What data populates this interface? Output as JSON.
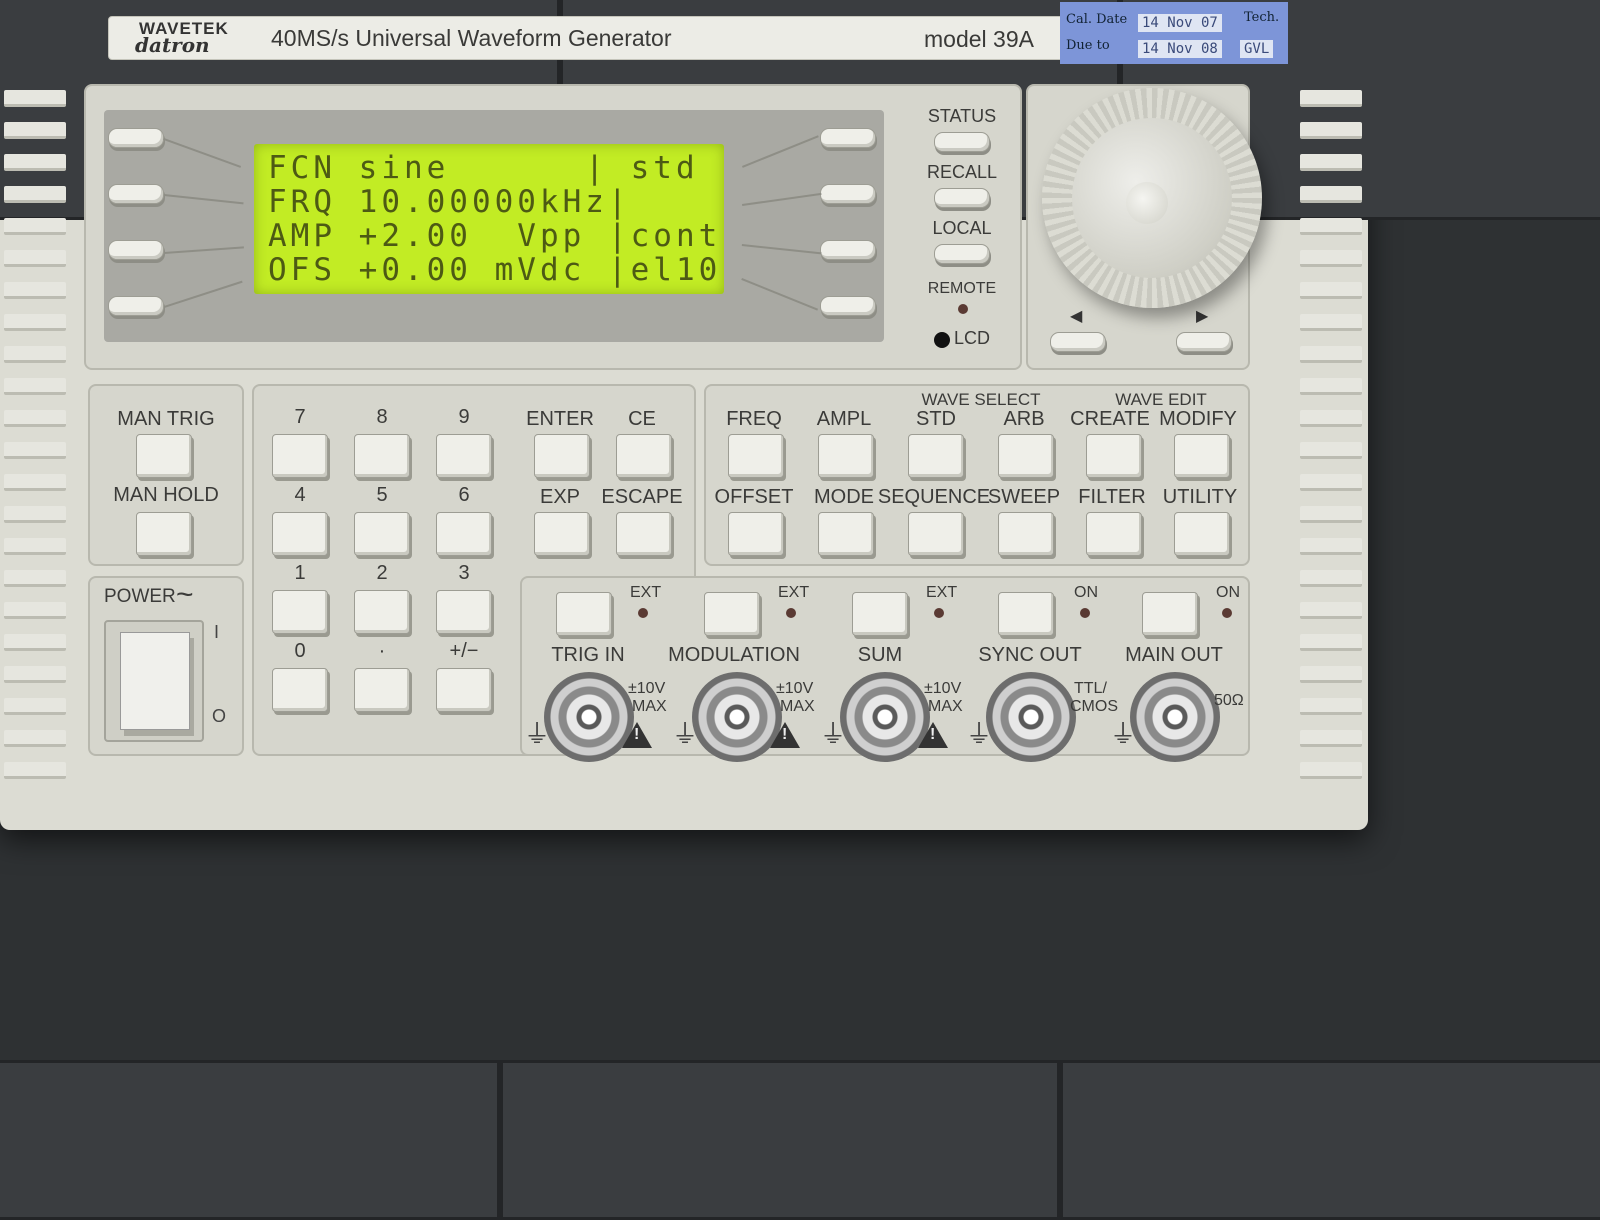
{
  "brand": {
    "line1": "WAVETEK",
    "line2": "datron"
  },
  "title": "40MS/s Universal Waveform Generator",
  "model": "model 39A",
  "calibration": {
    "cal_date_label": "Cal. Date",
    "cal_date": "14 Nov 07",
    "due_label": "Due to",
    "due_date": "14 Nov 08",
    "tech_label": "Tech.",
    "tech": "GVL"
  },
  "lcd": {
    "rows": [
      "FCN sine      | std",
      "FRQ 10.00000kHz|",
      "AMP +2.00  Vpp |cont",
      "OFS +0.00 mVdc |el10"
    ],
    "color": "#c2ec24"
  },
  "right_controls": {
    "status": "STATUS",
    "recall": "RECALL",
    "local": "LOCAL",
    "remote": "REMOTE",
    "lcd": "LCD"
  },
  "cursor": {
    "left": "◀",
    "right": "▶"
  },
  "trigger": {
    "man_trig": "MAN TRIG",
    "man_hold": "MAN HOLD"
  },
  "power": {
    "label": "POWER",
    "wave": "~",
    "on": "I",
    "off": "O"
  },
  "keypad": {
    "k7": "7",
    "k8": "8",
    "k9": "9",
    "k4": "4",
    "k5": "5",
    "k6": "6",
    "k1": "1",
    "k2": "2",
    "k3": "3",
    "k0": "0",
    "kdot": "·",
    "kpm": "+/−"
  },
  "entry": {
    "enter": "ENTER",
    "ce": "CE",
    "exp": "EXP",
    "escape": "ESCAPE"
  },
  "functions": {
    "wave_select": "WAVE SELECT",
    "wave_edit": "WAVE EDIT",
    "freq": "FREQ",
    "ampl": "AMPL",
    "std": "STD",
    "arb": "ARB",
    "create": "CREATE",
    "modify": "MODIFY",
    "offset": "OFFSET",
    "mode": "MODE",
    "sequence": "SEQUENCE",
    "sweep": "SWEEP",
    "filter": "FILTER",
    "utility": "UTILITY"
  },
  "outputs": {
    "ext": "EXT",
    "on": "ON",
    "trig_in": "TRIG IN",
    "modulation": "MODULATION",
    "sum": "SUM",
    "sync_out": "SYNC OUT",
    "main_out": "MAIN OUT",
    "pm10v": "±10V",
    "max": "MAX",
    "ttl": "TTL/",
    "cmos": "CMOS",
    "ohm": "50Ω"
  }
}
